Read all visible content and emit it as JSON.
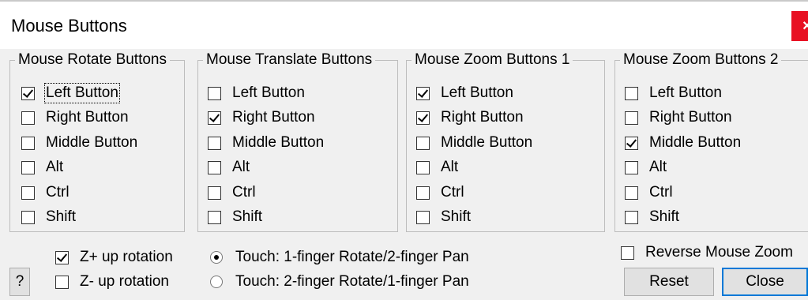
{
  "window": {
    "title": "Mouse Buttons",
    "close_glyph": "×"
  },
  "groups": [
    {
      "title": "Mouse Rotate Buttons",
      "options": [
        {
          "label": "Left Button",
          "checked": true
        },
        {
          "label": "Right Button",
          "checked": false
        },
        {
          "label": "Middle Button",
          "checked": false
        },
        {
          "label": "Alt",
          "checked": false
        },
        {
          "label": "Ctrl",
          "checked": false
        },
        {
          "label": "Shift",
          "checked": false
        }
      ]
    },
    {
      "title": "Mouse Translate Buttons",
      "options": [
        {
          "label": "Left Button",
          "checked": false
        },
        {
          "label": "Right Button",
          "checked": true
        },
        {
          "label": "Middle Button",
          "checked": false
        },
        {
          "label": "Alt",
          "checked": false
        },
        {
          "label": "Ctrl",
          "checked": false
        },
        {
          "label": "Shift",
          "checked": false
        }
      ]
    },
    {
      "title": "Mouse Zoom Buttons 1",
      "options": [
        {
          "label": "Left Button",
          "checked": true
        },
        {
          "label": "Right Button",
          "checked": true
        },
        {
          "label": "Middle Button",
          "checked": false
        },
        {
          "label": "Alt",
          "checked": false
        },
        {
          "label": "Ctrl",
          "checked": false
        },
        {
          "label": "Shift",
          "checked": false
        }
      ]
    },
    {
      "title": "Mouse Zoom Buttons 2",
      "options": [
        {
          "label": "Left Button",
          "checked": false
        },
        {
          "label": "Right Button",
          "checked": false
        },
        {
          "label": "Middle Button",
          "checked": true
        },
        {
          "label": "Alt",
          "checked": false
        },
        {
          "label": "Ctrl",
          "checked": false
        },
        {
          "label": "Shift",
          "checked": false
        }
      ]
    }
  ],
  "rotation": {
    "z_plus": {
      "label": "Z+ up rotation",
      "checked": true
    },
    "z_minus": {
      "label": "Z- up rotation",
      "checked": false
    }
  },
  "touch": [
    {
      "label": "Touch: 1-finger Rotate/2-finger Pan",
      "selected": true
    },
    {
      "label": "Touch: 2-finger Rotate/1-finger Pan",
      "selected": false
    }
  ],
  "reverse_zoom": {
    "label": "Reverse Mouse Zoom",
    "checked": false
  },
  "buttons": {
    "help": "?",
    "reset": "Reset",
    "close": "Close"
  }
}
